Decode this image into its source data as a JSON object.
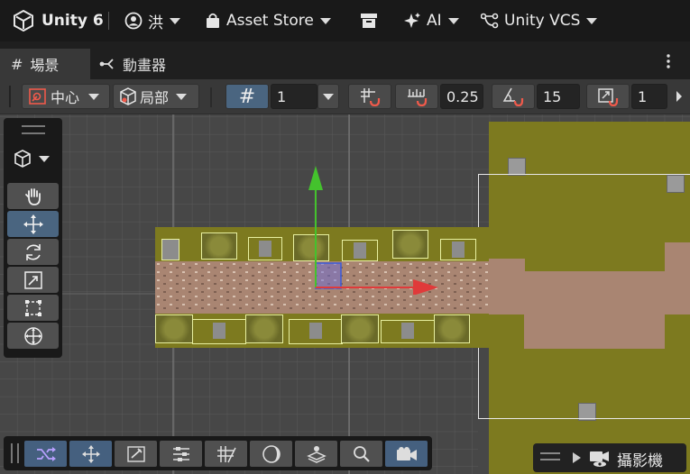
{
  "topbar": {
    "app": "Unity 6",
    "account": "洪",
    "asset_store": "Asset Store",
    "ai": "AI",
    "vcs": "Unity VCS"
  },
  "tabs": {
    "scene": "場景",
    "animator": "動畫器"
  },
  "scene_toolbar": {
    "pivot": "中心",
    "space": "局部",
    "grid_size": "1",
    "snap_increment": "0.25",
    "rotate_snap": "15",
    "scale_snap": "1"
  },
  "camera_overlay": {
    "label": "攝影機"
  },
  "colors": {
    "accent": "#4a6580",
    "grass": "#7d7a1f",
    "road": "#a98572",
    "gizmo_x": "#e03a3a",
    "gizmo_y": "#44c22d"
  }
}
